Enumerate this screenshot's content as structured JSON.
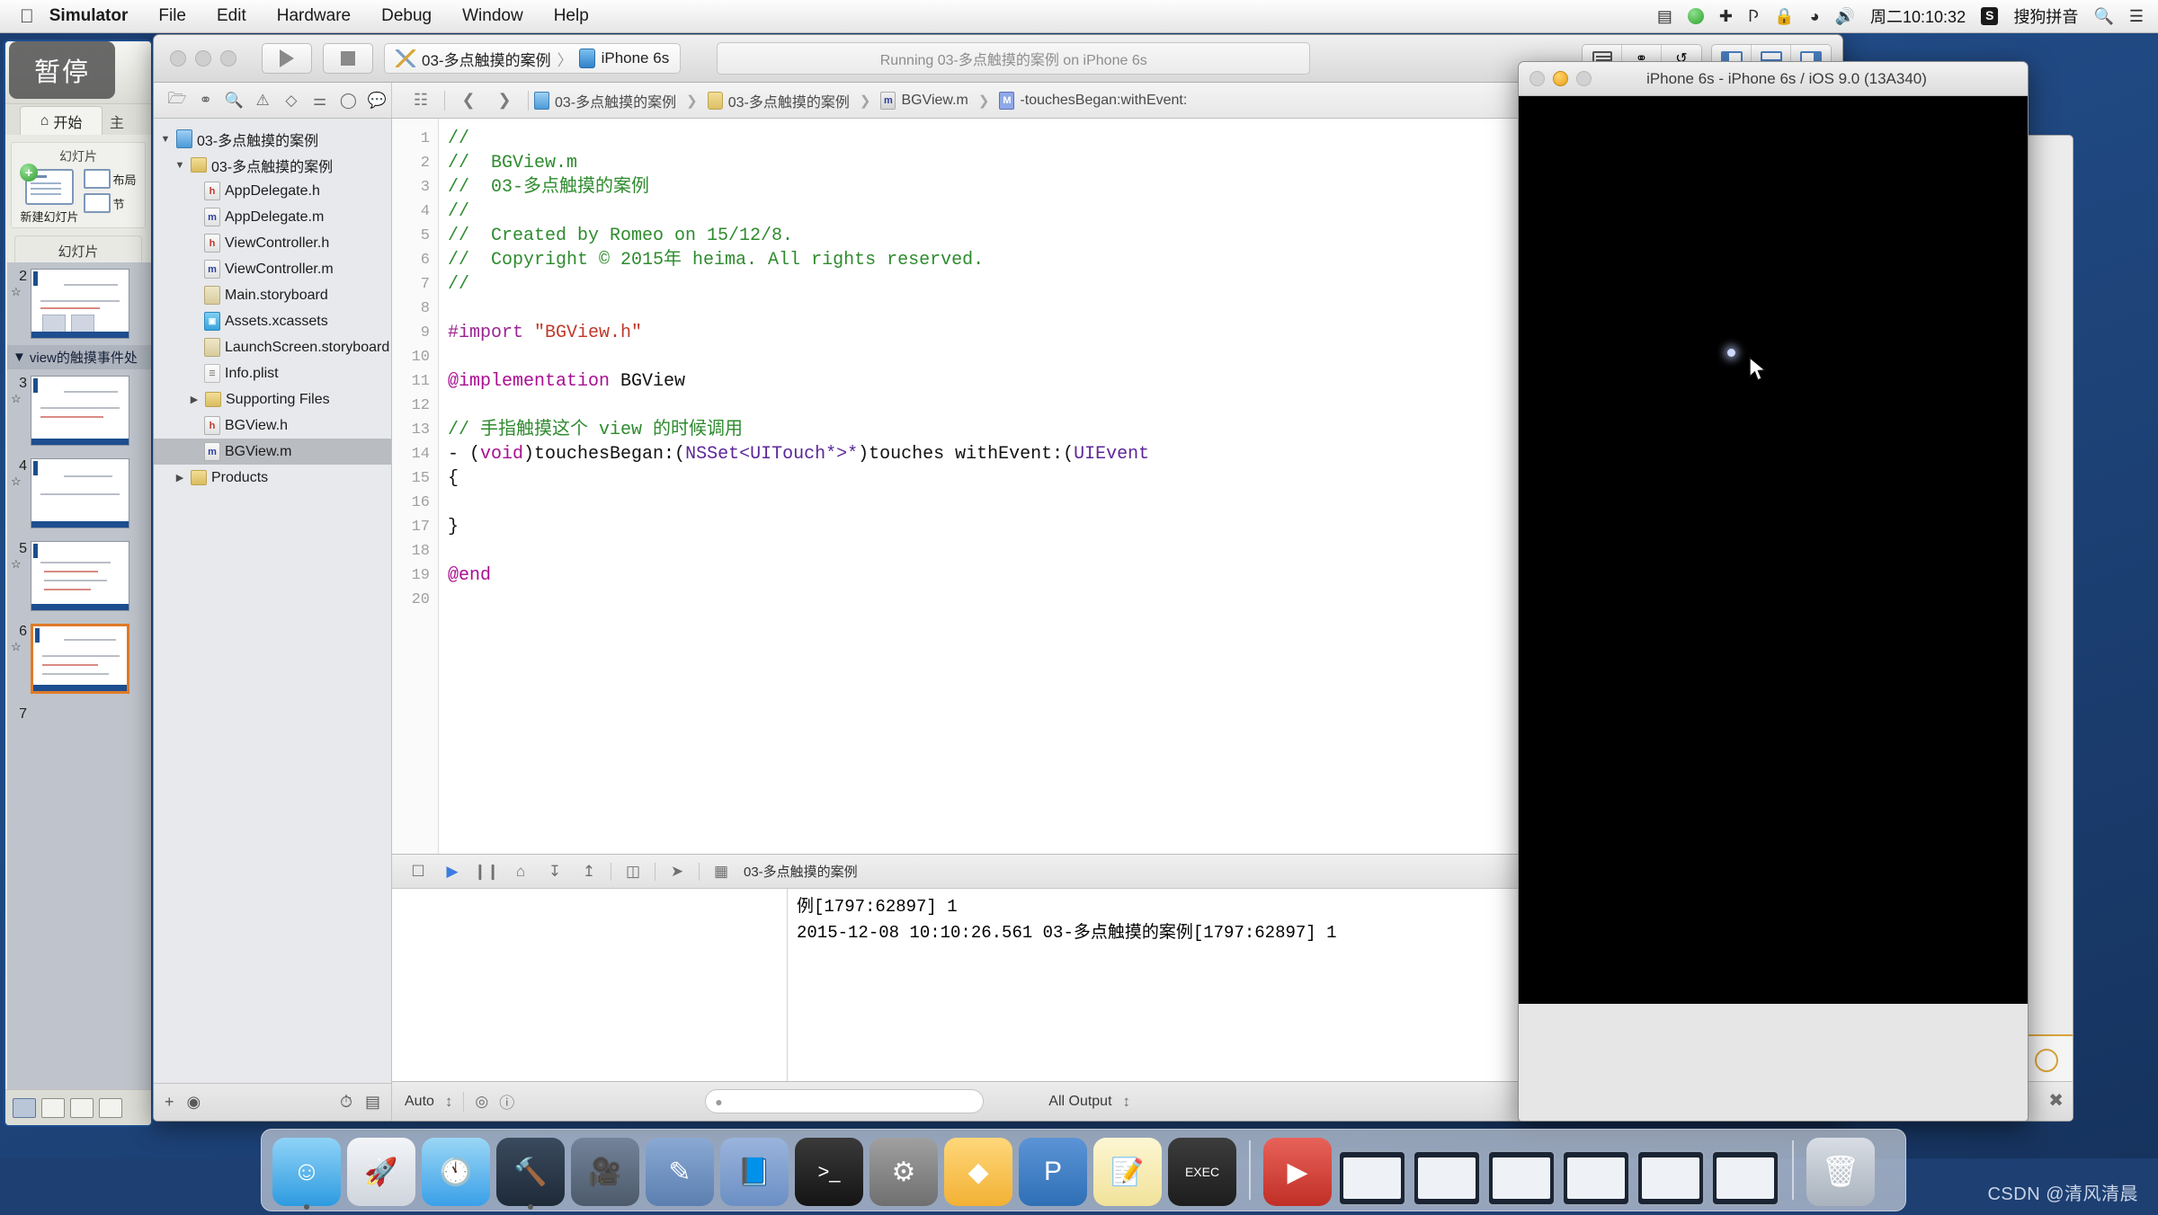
{
  "menubar": {
    "apple_icon": "apple-icon",
    "items": [
      {
        "label": "Simulator",
        "bold": true
      },
      {
        "label": "File",
        "bold": false
      },
      {
        "label": "Edit",
        "bold": false
      },
      {
        "label": "Hardware",
        "bold": false
      },
      {
        "label": "Debug",
        "bold": false
      },
      {
        "label": "Window",
        "bold": false
      },
      {
        "label": "Help",
        "bold": false
      }
    ],
    "status_icons": [
      "screen-record-icon",
      "player-icon",
      "airplane-icon",
      "bluetooth-icon",
      "lock-icon",
      "wifi-icon",
      "volume-icon"
    ],
    "clock": "周二10:10:32",
    "input_method_badge": "S",
    "input_method": "搜狗拼音",
    "search_icon": "search-icon",
    "notification_icon": "notification-center-icon"
  },
  "powerpoint": {
    "pause_overlay": "暂停",
    "tab_home": "开始",
    "tab_other": "主",
    "group_title": "幻灯片",
    "new_slide_label": "新建幻灯片",
    "layout_label": "布局",
    "section_label": "节",
    "subbar_label": "幻灯片",
    "outline_section": "view的触摸事件处",
    "slides": [
      {
        "number": "2",
        "selected": false
      },
      {
        "number": "3",
        "selected": false
      },
      {
        "number": "4",
        "selected": false
      },
      {
        "number": "5",
        "selected": false
      },
      {
        "number": "6",
        "selected": true
      },
      {
        "number": "7",
        "selected": false
      }
    ]
  },
  "xcode": {
    "toolbar": {
      "run_icon": "run-play-icon",
      "stop_icon": "stop-square-icon",
      "scheme_name": "03-多点触摸的案例",
      "scheme_separator": "〉",
      "destination": "iPhone 6s",
      "status_text": "Running 03-多点触摸的案例 on iPhone 6s",
      "editor_segments": [
        "standard-editor-icon",
        "assistant-editor-icon",
        "version-editor-icon"
      ],
      "panel_segments": [
        "navigator-toggle-icon",
        "debug-area-toggle-icon",
        "utilities-toggle-icon"
      ]
    },
    "navigator_toolbar": [
      "folder-icon",
      "branch-icon",
      "search-icon",
      "warning-icon",
      "issue-icon",
      "test-icon",
      "tag-icon",
      "report-icon"
    ],
    "jumpbar": {
      "related_icon": "related-items-icon",
      "back_icon": "chevron-left-icon",
      "forward_icon": "chevron-right-icon",
      "crumbs": [
        {
          "label": "03-多点触摸的案例",
          "icon": "project-icon"
        },
        {
          "label": "03-多点触摸的案例",
          "icon": "folder-icon"
        },
        {
          "label": "BGView.m",
          "icon": "m-file-icon"
        },
        {
          "label": "-touchesBegan:withEvent:",
          "icon": "method-icon"
        }
      ]
    },
    "navigator": {
      "items": [
        {
          "label": "03-多点触摸的案例",
          "kind": "proj",
          "indent": 0,
          "disclosure": "▼",
          "selected": false
        },
        {
          "label": "03-多点触摸的案例",
          "kind": "folder",
          "indent": 1,
          "disclosure": "▼",
          "selected": false
        },
        {
          "label": "AppDelegate.h",
          "kind": "h",
          "indent": 2,
          "disclosure": "",
          "selected": false
        },
        {
          "label": "AppDelegate.m",
          "kind": "m",
          "indent": 2,
          "disclosure": "",
          "selected": false
        },
        {
          "label": "ViewController.h",
          "kind": "h",
          "indent": 2,
          "disclosure": "",
          "selected": false
        },
        {
          "label": "ViewController.m",
          "kind": "m",
          "indent": 2,
          "disclosure": "",
          "selected": false
        },
        {
          "label": "Main.storyboard",
          "kind": "sb",
          "indent": 2,
          "disclosure": "",
          "selected": false
        },
        {
          "label": "Assets.xcassets",
          "kind": "xca",
          "indent": 2,
          "disclosure": "",
          "selected": false
        },
        {
          "label": "LaunchScreen.storyboard",
          "kind": "sb",
          "indent": 2,
          "disclosure": "",
          "selected": false
        },
        {
          "label": "Info.plist",
          "kind": "plist",
          "indent": 2,
          "disclosure": "",
          "selected": false
        },
        {
          "label": "Supporting Files",
          "kind": "folder",
          "indent": 2,
          "disclosure": "▶",
          "selected": false
        },
        {
          "label": "BGView.h",
          "kind": "h",
          "indent": 2,
          "disclosure": "",
          "selected": false
        },
        {
          "label": "BGView.m",
          "kind": "m",
          "indent": 2,
          "disclosure": "",
          "selected": true
        },
        {
          "label": "Products",
          "kind": "folder",
          "indent": 1,
          "disclosure": "▶",
          "selected": false
        }
      ],
      "bottom_icons": [
        "add-icon",
        "filter-icon",
        "recent-icon",
        "unsaved-icon"
      ]
    },
    "editor": {
      "line_numbers": [
        "1",
        "2",
        "3",
        "4",
        "5",
        "6",
        "7",
        "8",
        "9",
        "10",
        "11",
        "12",
        "13",
        "14",
        "15",
        "16",
        "17",
        "18",
        "19",
        "20"
      ],
      "lines": [
        [
          {
            "t": "//",
            "c": "com"
          }
        ],
        [
          {
            "t": "//  BGView.m",
            "c": "com"
          }
        ],
        [
          {
            "t": "//  03-多点触摸的案例",
            "c": "com"
          }
        ],
        [
          {
            "t": "//",
            "c": "com"
          }
        ],
        [
          {
            "t": "//  Created by Romeo on 15/12/8.",
            "c": "com"
          }
        ],
        [
          {
            "t": "//  Copyright © 2015年 heima. All rights reserved.",
            "c": "com"
          }
        ],
        [
          {
            "t": "//",
            "c": "com"
          }
        ],
        [
          {
            "t": "",
            "c": ""
          }
        ],
        [
          {
            "t": "#import ",
            "c": "pre"
          },
          {
            "t": "\"BGView.h\"",
            "c": "str"
          }
        ],
        [
          {
            "t": "",
            "c": ""
          }
        ],
        [
          {
            "t": "@implementation",
            "c": "kw"
          },
          {
            "t": " BGView",
            "c": ""
          }
        ],
        [
          {
            "t": "",
            "c": ""
          }
        ],
        [
          {
            "t": "// 手指触摸这个 view 的时候调用",
            "c": "com"
          }
        ],
        [
          {
            "t": "- (",
            "c": ""
          },
          {
            "t": "void",
            "c": "kw"
          },
          {
            "t": ")touchesBegan:(",
            "c": ""
          },
          {
            "t": "NSSet<UITouch*>*",
            "c": "type"
          },
          {
            "t": ")touches withEvent:(",
            "c": ""
          },
          {
            "t": "UIEvent",
            "c": "type"
          },
          {
            "t": "",
            "c": ""
          }
        ],
        [
          {
            "t": "{",
            "c": ""
          }
        ],
        [
          {
            "t": "",
            "c": ""
          }
        ],
        [
          {
            "t": "}",
            "c": ""
          }
        ],
        [
          {
            "t": "",
            "c": ""
          }
        ],
        [
          {
            "t": "@end",
            "c": "kw"
          }
        ],
        [
          {
            "t": "",
            "c": ""
          }
        ]
      ]
    },
    "debug_toolbar": {
      "icons": [
        "hide-debug-icon",
        "continue-icon",
        "pause-icon",
        "step-over-icon",
        "step-into-icon",
        "step-out-icon",
        "view-hierarchy-icon",
        "location-icon",
        "process-icon"
      ],
      "process_label": "03-多点触摸的案例"
    },
    "console": {
      "output": "例[1797:62897] 1\n2015-12-08 10:10:26.561 03-多点触摸的案例[1797:62897] 1"
    },
    "statusbar": {
      "auto_label": "Auto",
      "stepper_icon": "updown-chevron-icon",
      "target_icon": "target-icon",
      "info_icon": "info-icon",
      "filter_placeholder": "",
      "all_output_label": "All Output",
      "all_output_chevron": "updown-chevron-icon",
      "trash_icon": "trash-icon",
      "split_icons": [
        "variables-pane-icon",
        "console-pane-icon"
      ],
      "grid_icon": "grid-icon",
      "circle_icon": "filter-circle-icon"
    }
  },
  "simulator": {
    "title": "iPhone 6s - iPhone 6s / iOS 9.0 (13A340)",
    "screen_color": "#000000",
    "touch_indicator": "touch-dot",
    "cursor": "mouse-pointer"
  },
  "dock": {
    "apps": [
      {
        "name": "finder-icon",
        "color": "#2e9be0",
        "glyph": "🙂"
      },
      {
        "name": "launchpad-icon",
        "color": "#d9dde4",
        "glyph": "🚀"
      },
      {
        "name": "safari-icon",
        "color": "#3aa0e8",
        "glyph": "🧭"
      },
      {
        "name": "xcode-icon",
        "color": "#1e2a38",
        "glyph": "🔨"
      },
      {
        "name": "quicktime-icon",
        "color": "#4c5a6b",
        "glyph": "🎬"
      },
      {
        "name": "editor-icon",
        "color": "#5b7fb0",
        "glyph": "✎"
      },
      {
        "name": "notes-blue-icon",
        "color": "#6b8fc4",
        "glyph": "📘"
      },
      {
        "name": "terminal-icon",
        "color": "#1a1a1a",
        "glyph": ">_"
      },
      {
        "name": "system-preferences-icon",
        "color": "#7d7d7d",
        "glyph": "⚙"
      },
      {
        "name": "sketch-icon",
        "color": "#f2b134",
        "glyph": "◆"
      },
      {
        "name": "keynote-icon",
        "color": "#2f6fb5",
        "glyph": "P"
      },
      {
        "name": "notes-icon",
        "color": "#f6e7a8",
        "glyph": "📝"
      },
      {
        "name": "script-editor-icon",
        "color": "#2b2b2b",
        "glyph": "EXEC"
      }
    ],
    "media_app": {
      "name": "media-player-icon",
      "color": "#cf3a2e",
      "glyph": "▶"
    },
    "minimized_windows": 6,
    "trash": {
      "name": "trash-icon",
      "glyph": "🗑"
    }
  },
  "watermark": "CSDN @清风清晨"
}
